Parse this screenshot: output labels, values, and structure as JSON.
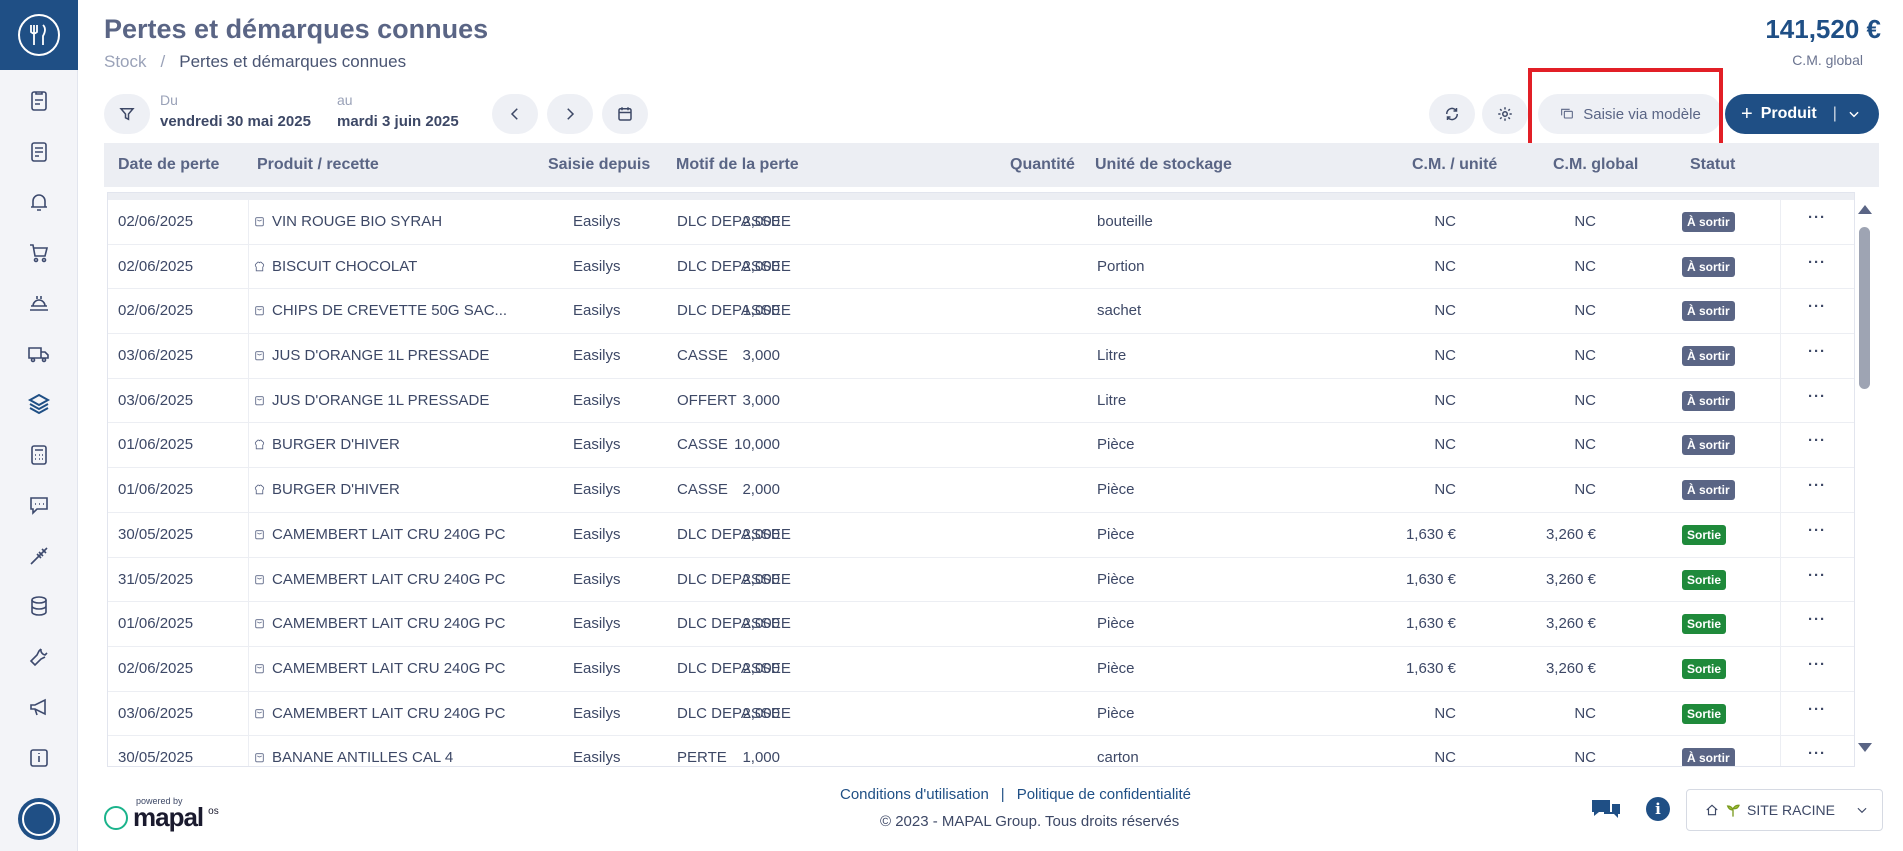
{
  "header": {
    "title": "Pertes et démarques connues",
    "breadcrumb_root": "Stock",
    "breadcrumb_sep": "/",
    "breadcrumb_current": "Pertes et démarques connues",
    "total_value": "141,520 €",
    "total_label": "C.M. global"
  },
  "toolbar": {
    "from_label": "Du",
    "from_value": "vendredi 30 mai 2025",
    "to_label": "au",
    "to_value": "mardi 3 juin 2025",
    "model_button": "Saisie via modèle",
    "product_button": "Produit",
    "product_plus": "+",
    "product_sep": "|"
  },
  "table": {
    "columns": {
      "date": "Date de perte",
      "product": "Produit / recette",
      "source": "Saisie depuis",
      "motif": "Motif de la perte",
      "qty": "Quantité",
      "unit": "Unité de stockage",
      "cmu": "C.M. / unité",
      "cmg": "C.M. global",
      "status": "Statut"
    },
    "rows": [
      {
        "date": "02/06/2025",
        "product": "VIN ROUGE BIO SYRAH",
        "type": "product",
        "source": "Easilys",
        "motif": "DLC DEPASSEE",
        "qty": "2,000",
        "unit": "bouteille",
        "cmu": "NC",
        "cmg": "NC",
        "status": "À sortir"
      },
      {
        "date": "02/06/2025",
        "product": "BISCUIT CHOCOLAT",
        "type": "recipe",
        "source": "Easilys",
        "motif": "DLC DEPASSEE",
        "qty": "2,000",
        "unit": "Portion",
        "cmu": "NC",
        "cmg": "NC",
        "status": "À sortir"
      },
      {
        "date": "02/06/2025",
        "product": "CHIPS DE CREVETTE 50G SAC...",
        "type": "product",
        "source": "Easilys",
        "motif": "DLC DEPASSEE",
        "qty": "1,000",
        "unit": "sachet",
        "cmu": "NC",
        "cmg": "NC",
        "status": "À sortir"
      },
      {
        "date": "03/06/2025",
        "product": "JUS D'ORANGE 1L PRESSADE",
        "type": "product",
        "source": "Easilys",
        "motif": "CASSE",
        "qty": "3,000",
        "unit": "Litre",
        "cmu": "NC",
        "cmg": "NC",
        "status": "À sortir"
      },
      {
        "date": "03/06/2025",
        "product": "JUS D'ORANGE 1L PRESSADE",
        "type": "product",
        "source": "Easilys",
        "motif": "OFFERT",
        "qty": "3,000",
        "unit": "Litre",
        "cmu": "NC",
        "cmg": "NC",
        "status": "À sortir"
      },
      {
        "date": "01/06/2025",
        "product": "BURGER D'HIVER",
        "type": "recipe",
        "source": "Easilys",
        "motif": "CASSE",
        "qty": "10,000",
        "unit": "Pièce",
        "cmu": "NC",
        "cmg": "NC",
        "status": "À sortir"
      },
      {
        "date": "01/06/2025",
        "product": "BURGER D'HIVER",
        "type": "recipe",
        "source": "Easilys",
        "motif": "CASSE",
        "qty": "2,000",
        "unit": "Pièce",
        "cmu": "NC",
        "cmg": "NC",
        "status": "À sortir"
      },
      {
        "date": "30/05/2025",
        "product": "CAMEMBERT LAIT CRU 240G PC",
        "type": "product",
        "source": "Easilys",
        "motif": "DLC DEPASSEE",
        "qty": "2,000",
        "unit": "Pièce",
        "cmu": "1,630 €",
        "cmg": "3,260 €",
        "status": "Sortie"
      },
      {
        "date": "31/05/2025",
        "product": "CAMEMBERT LAIT CRU 240G PC",
        "type": "product",
        "source": "Easilys",
        "motif": "DLC DEPASSEE",
        "qty": "2,000",
        "unit": "Pièce",
        "cmu": "1,630 €",
        "cmg": "3,260 €",
        "status": "Sortie"
      },
      {
        "date": "01/06/2025",
        "product": "CAMEMBERT LAIT CRU 240G PC",
        "type": "product",
        "source": "Easilys",
        "motif": "DLC DEPASSEE",
        "qty": "2,000",
        "unit": "Pièce",
        "cmu": "1,630 €",
        "cmg": "3,260 €",
        "status": "Sortie"
      },
      {
        "date": "02/06/2025",
        "product": "CAMEMBERT LAIT CRU 240G PC",
        "type": "product",
        "source": "Easilys",
        "motif": "DLC DEPASSEE",
        "qty": "2,000",
        "unit": "Pièce",
        "cmu": "1,630 €",
        "cmg": "3,260 €",
        "status": "Sortie"
      },
      {
        "date": "03/06/2025",
        "product": "CAMEMBERT LAIT CRU 240G PC",
        "type": "product",
        "source": "Easilys",
        "motif": "DLC DEPASSEE",
        "qty": "2,000",
        "unit": "Pièce",
        "cmu": "NC",
        "cmg": "NC",
        "status": "Sortie"
      },
      {
        "date": "30/05/2025",
        "product": "BANANE ANTILLES CAL 4",
        "type": "product",
        "source": "Easilys",
        "motif": "PERTE",
        "qty": "1,000",
        "unit": "carton",
        "cmu": "NC",
        "cmg": "NC",
        "status": "À sortir"
      }
    ],
    "more_label": "···"
  },
  "footer": {
    "powered_by": "powered by",
    "brand": "mapal",
    "brand_suffix": "os",
    "terms": "Conditions d'utilisation",
    "sep": "|",
    "privacy": "Politique de confidentialité",
    "copyright": "© 2023 - MAPAL Group. Tous droits réservés",
    "site": "SITE RACINE"
  },
  "colors": {
    "brand": "#1f4f85",
    "status_pending": "#5a6585",
    "status_done": "#1f8a3b",
    "highlight": "#e21f26"
  },
  "sidebar_icons": [
    "clipboard-icon",
    "document-icon",
    "bell-icon",
    "cart-icon",
    "dish-icon",
    "truck-icon",
    "stack-icon",
    "calculator-icon",
    "chat-icon",
    "tool-icon",
    "database-icon",
    "wrench-icon",
    "megaphone-icon",
    "info-icon"
  ]
}
